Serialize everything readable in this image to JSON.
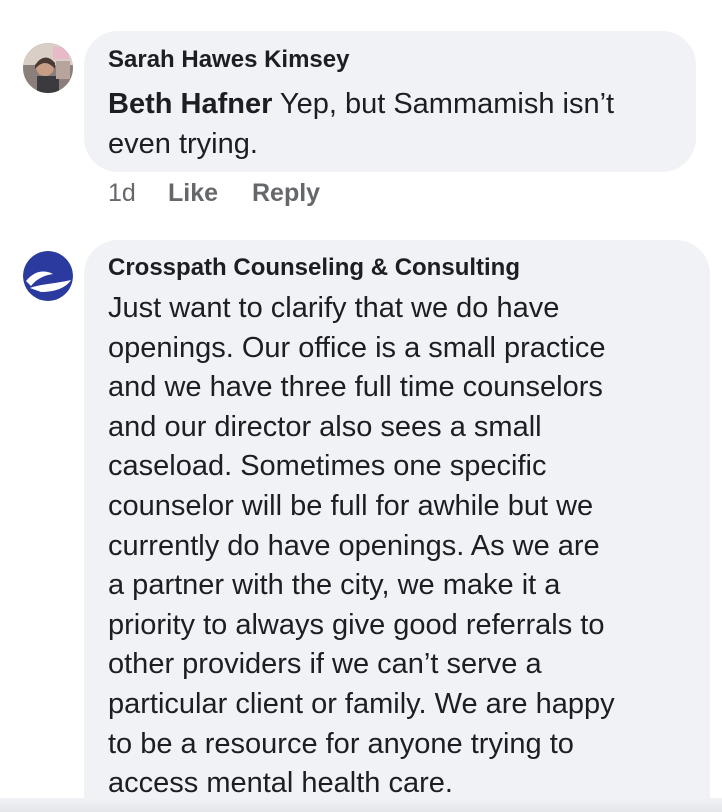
{
  "comments": [
    {
      "author": "Sarah Hawes Kimsey",
      "tagged_name": "Beth Hafner",
      "text_after_tag": " Yep, but Sammamish isn’t even trying.",
      "avatar_icon": "user-photo-avatar",
      "actions": {
        "time": "1d",
        "like_label": "Like",
        "reply_label": "Reply"
      }
    },
    {
      "author": "Crosspath Counseling & Consulting",
      "avatar_icon": "crosspath-logo-avatar",
      "text_lines": [
        "Just want to clarify that we do have",
        "openings.  Our office is a small practice",
        "and we have three full time counselors",
        "and our director also sees a small",
        "caseload.  Sometimes one specific",
        "counselor will be full for awhile but we",
        "currently do have openings.  As we are",
        "a partner with the city, we make it a",
        "priority to always give good referrals to",
        "other providers if we can’t serve a",
        "particular client or family.  We are happy",
        "to be a resource for anyone trying to",
        "access mental health care."
      ]
    }
  ],
  "colors": {
    "bubble_bg": "#f0f2f5",
    "text": "#1c1e21",
    "secondary_text": "#65676b",
    "logo_blue": "#2b3a9e"
  }
}
